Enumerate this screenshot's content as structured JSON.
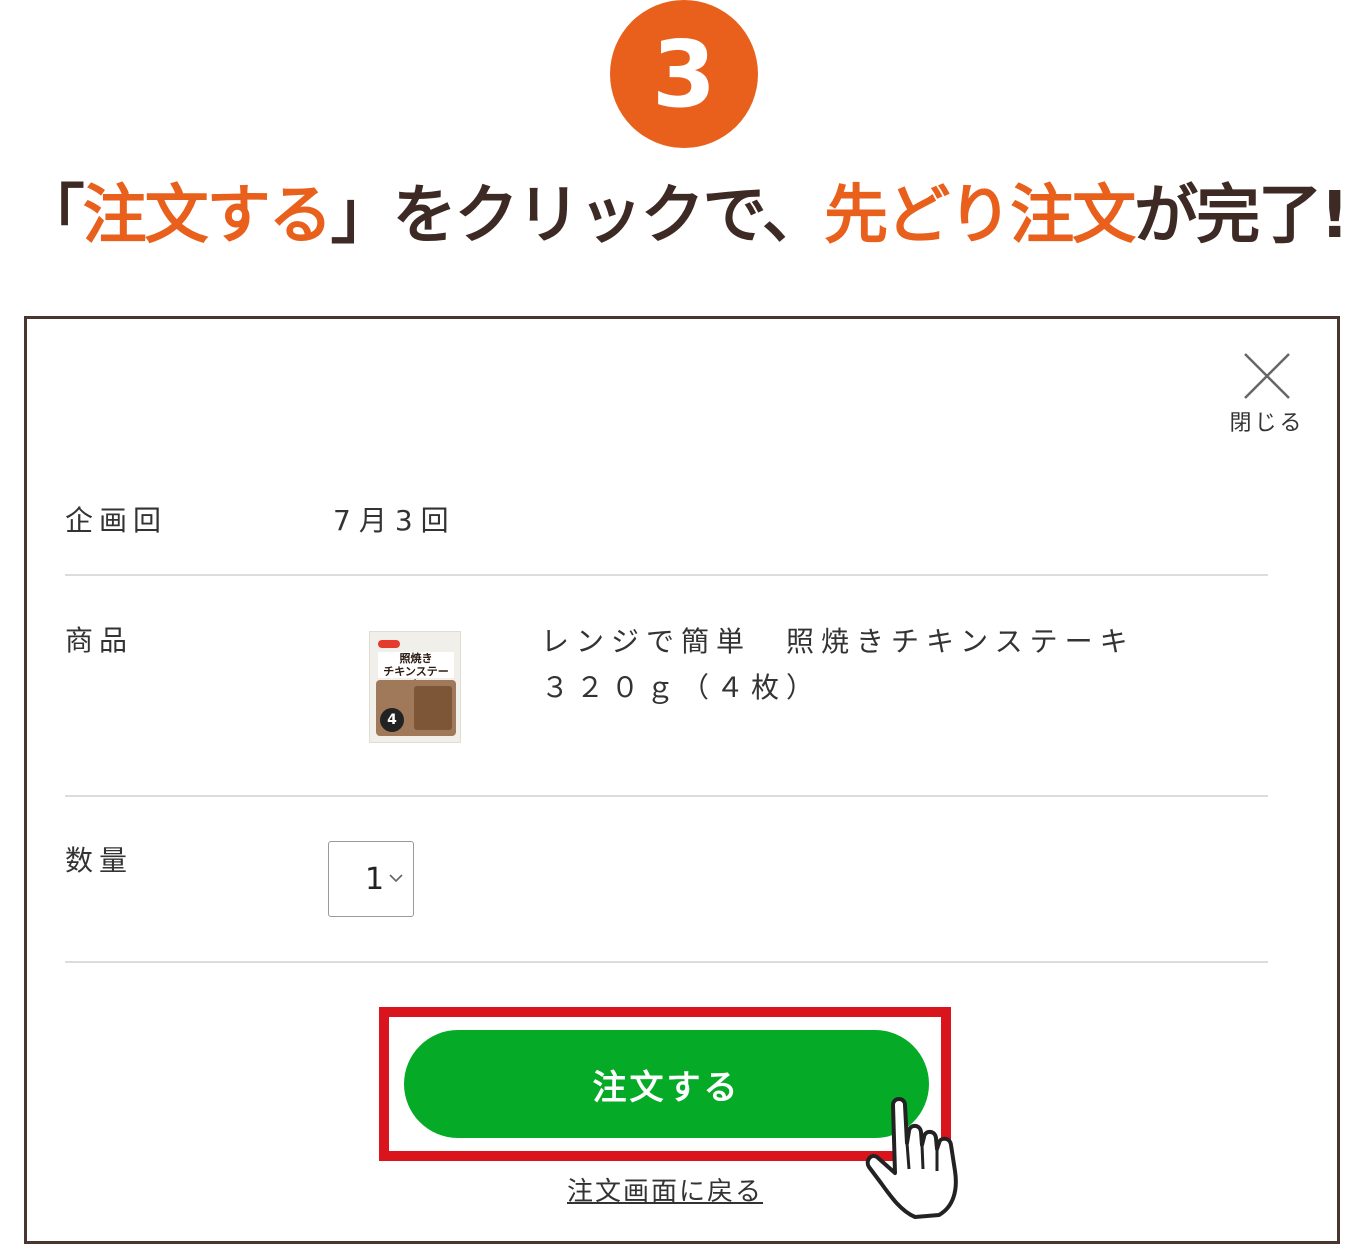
{
  "step": {
    "number": "3"
  },
  "headline": {
    "open_bracket": "「",
    "part1_highlight": "注文する",
    "close_bracket": "」",
    "part2": "をクリックで、",
    "part3_highlight": "先どり注文",
    "part4": "が完了!"
  },
  "modal": {
    "close_label": "閉じる",
    "plan_label": "企画回",
    "plan_value": "7月3回",
    "product_label": "商品",
    "product_name_line1": "レンジで簡単　照焼きチキンステーキ",
    "product_name_line2": "３２０ｇ（４枚）",
    "product_thumb_text": "照焼き\nチキンステーキ",
    "product_thumb_badge": "4",
    "quantity_label": "数量",
    "quantity_value": "1",
    "order_button_label": "注文する",
    "back_link_label": "注文画面に戻る"
  },
  "colors": {
    "accent_orange": "#e8601c",
    "headline_brown": "#3d2a24",
    "frame_brown": "#4a3631",
    "order_green": "#05ab26",
    "highlight_red": "#d9141c"
  },
  "icons": [
    "close-icon",
    "chevron-down-icon",
    "pointing-hand-icon"
  ]
}
